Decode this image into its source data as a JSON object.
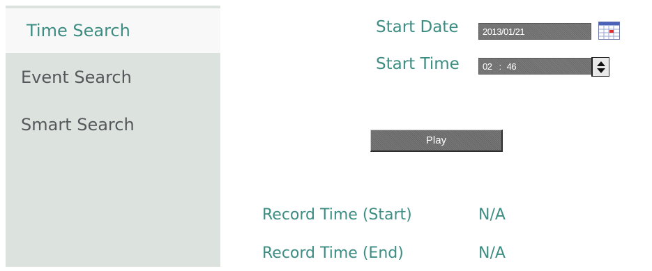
{
  "sidebar": {
    "items": [
      {
        "label": "Time Search"
      },
      {
        "label": "Event Search"
      },
      {
        "label": "Smart Search"
      }
    ]
  },
  "form": {
    "start_date_label": "Start Date",
    "start_date_value": "2013/01/21",
    "start_time_label": "Start Time",
    "start_time_hour": "02",
    "start_time_sep": ":",
    "start_time_minute": "46",
    "play_label": "Play"
  },
  "record": {
    "start_label": "Record Time (Start)",
    "start_value": "N/A",
    "end_label": "Record Time (End)",
    "end_value": "N/A"
  },
  "icons": {
    "calendar": "calendar-icon",
    "spinner": "spin-buttons"
  },
  "colors": {
    "accent": "#3d8d83",
    "sidebar_bg": "#dce3de",
    "sidebar_active_bg": "#f7f8f7",
    "control_bg": "#777777"
  }
}
